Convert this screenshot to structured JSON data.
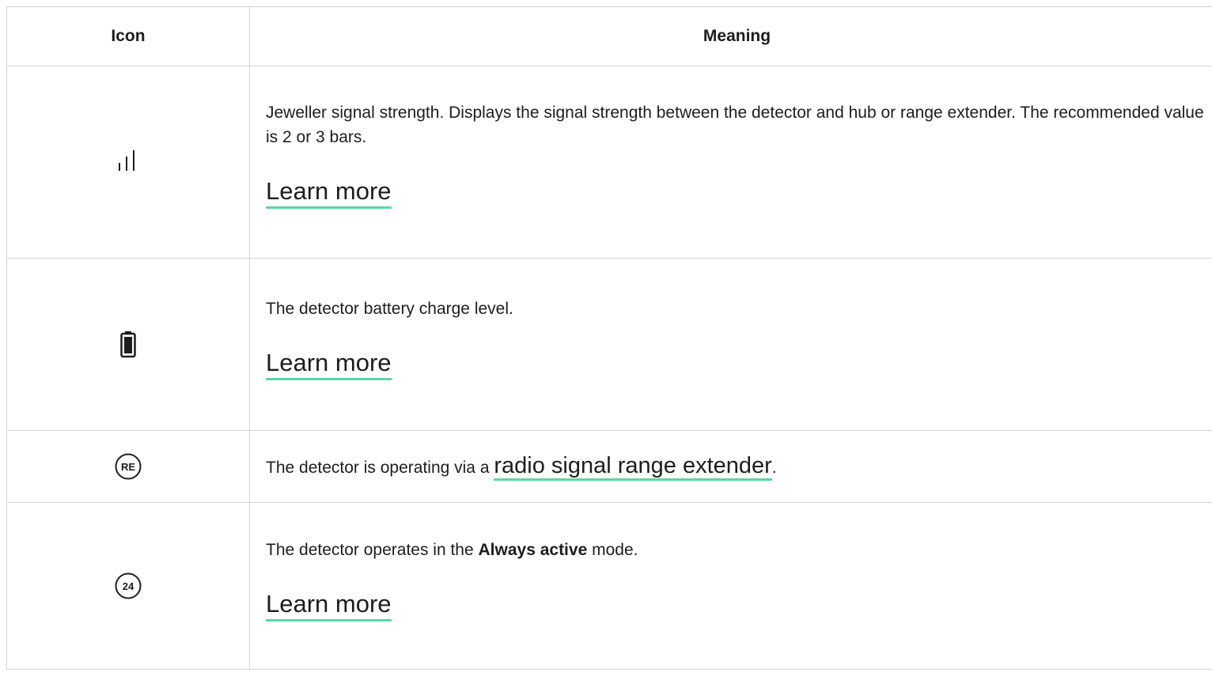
{
  "table": {
    "headers": {
      "icon": "Icon",
      "meaning": "Meaning"
    },
    "rows": [
      {
        "icon": "signal-strength-icon",
        "text": "Jeweller signal strength. Displays the signal strength between the detector and hub or range extender. The recommended value is 2 or 3 bars.",
        "link": "Learn more"
      },
      {
        "icon": "battery-icon",
        "text": "The detector battery charge level.",
        "link": "Learn more"
      },
      {
        "icon": "range-extender-icon",
        "icon_text": "RE",
        "text_before": "The detector is operating via a ",
        "link": "radio signal range extender",
        "text_after": "."
      },
      {
        "icon": "always-active-icon",
        "icon_text": "24",
        "text_before": "The detector operates in the ",
        "bold": "Always active",
        "text_after": " mode.",
        "link": "Learn more"
      }
    ]
  },
  "colors": {
    "link_underline": "#5bd6a4",
    "border": "#d4d4d4",
    "text": "#1d1d1d"
  }
}
